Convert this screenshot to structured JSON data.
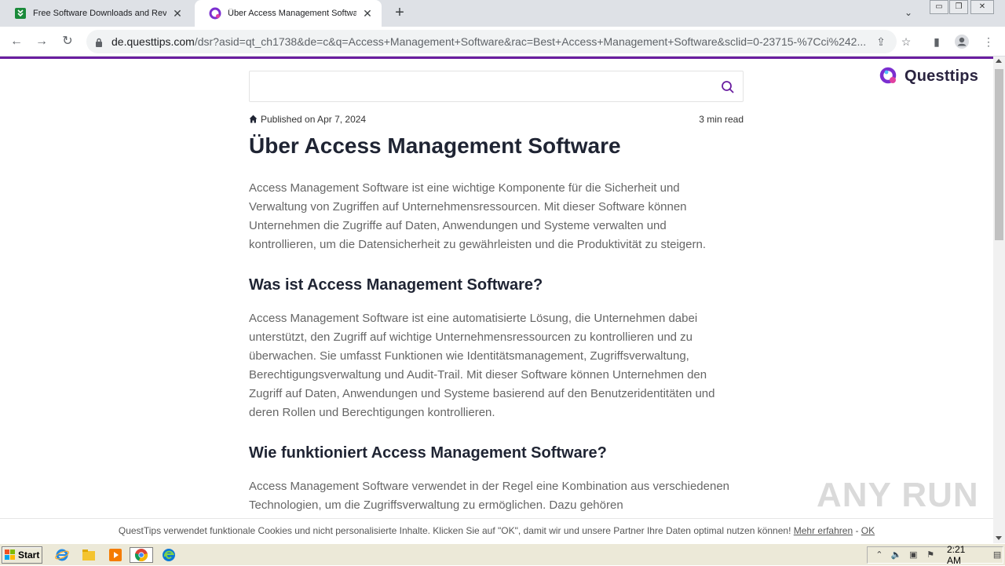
{
  "browser": {
    "tabs": [
      {
        "title": "Free Software Downloads and Revie",
        "active": false,
        "favicon": "softonic-icon"
      },
      {
        "title": "Über Access Management Software",
        "active": true,
        "favicon": "questtips-icon"
      }
    ],
    "url_host": "de.questtips.com",
    "url_rest": "/dsr?asid=qt_ch1738&de=c&q=Access+Management+Software&rac=Best+Access+Management+Software&sclid=0-23715-%7Cci%242..."
  },
  "site": {
    "logo_text": "Questtips",
    "brand_color": "#6a1ea0"
  },
  "article": {
    "published": "Published on Apr 7, 2024",
    "read_time": "3 min read",
    "title": "Über Access Management Software",
    "intro": "Access Management Software ist eine wichtige Komponente für die Sicherheit und Verwaltung von Zugriffen auf Unternehmensressourcen. Mit dieser Software können Unternehmen die Zugriffe auf Daten, Anwendungen und Systeme verwalten und kontrollieren, um die Datensicherheit zu gewährleisten und die Produktivität zu steigern.",
    "h2_1": "Was ist Access Management Software?",
    "p_1": "Access Management Software ist eine automatisierte Lösung, die Unternehmen dabei unterstützt, den Zugriff auf wichtige Unternehmensressourcen zu kontrollieren und zu überwachen. Sie umfasst Funktionen wie Identitätsmanagement, Zugriffsverwaltung, Berechtigungsverwaltung und Audit-Trail. Mit dieser Software können Unternehmen den Zugriff auf Daten, Anwendungen und Systeme basierend auf den Benutzeridentitäten und deren Rollen und Berechtigungen kontrollieren.",
    "h2_2": "Wie funktioniert Access Management Software?",
    "p_2": "Access Management Software verwendet in der Regel eine Kombination aus verschiedenen Technologien, um die Zugriffsverwaltung zu ermöglichen. Dazu gehören"
  },
  "cookie": {
    "text": "QuestTips verwendet funktionale Cookies und nicht personalisierte Inhalte. Klicken Sie auf \"OK\", damit wir und unsere Partner Ihre Daten optimal nutzen können!",
    "more": "Mehr erfahren",
    "sep": " - ",
    "ok": "OK"
  },
  "watermark": "ANY RUN",
  "taskbar": {
    "start": "Start",
    "clock": "2:21 AM"
  }
}
